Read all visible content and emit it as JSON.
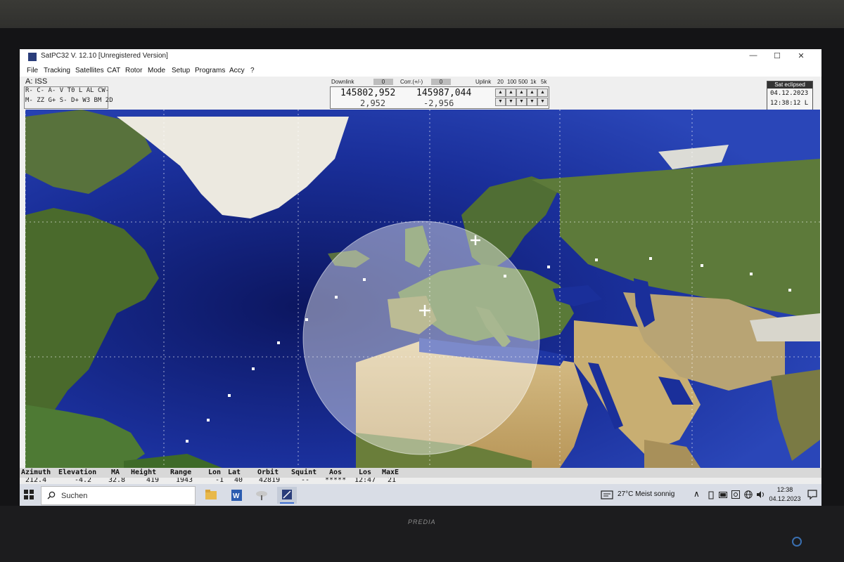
{
  "window": {
    "title": "SatPC32 V. 12.10   [Unregistered Version]",
    "controls": [
      "—",
      "☐",
      "✕"
    ]
  },
  "menu": [
    "File",
    "Tracking",
    "Satellites",
    "CAT",
    "Rotor",
    "Mode",
    "Setup",
    "Programs",
    "Accy",
    "?"
  ],
  "satellite": "A: ISS",
  "modes": {
    "line1": "R- C- A-  V  T0  L  AL  CW-",
    "line2": "M- ZZ G+  S-  D+  W3  BM  2D"
  },
  "frequency": {
    "downlink_label": "Downlink",
    "downlink_value": "0",
    "corr_label": "Corr.(+/-)",
    "corr_value": "0",
    "uplink_label": "Uplink",
    "steps": [
      "20",
      "100",
      "500",
      "1k",
      "5k"
    ],
    "downlink_freq": "145802,952",
    "uplink_freq": "145987,044",
    "downlink_shift": "2,952",
    "uplink_shift": "-2,956"
  },
  "status": {
    "state": "Sat eclipsed",
    "date": "04.12.2023",
    "time": "12:38:12 L"
  },
  "table": {
    "headers": [
      "Azimuth",
      "Elevation",
      "MA",
      "Height",
      "Range",
      "Lon",
      "Lat",
      "Orbit",
      "Squint",
      "Aos",
      "Los",
      "MaxE"
    ],
    "row": [
      "212.4",
      "-4.2",
      "32.8",
      "419",
      "1943",
      "-1",
      "40",
      "42819",
      "--",
      "*****",
      "12:47",
      "21"
    ]
  },
  "taskbar": {
    "search_placeholder": "Suchen",
    "weather": "27°C  Meist sonnig",
    "time": "12:38",
    "date": "04.12.2023"
  },
  "monitor_brand": "PREDIA",
  "colors": {
    "ocean": "#1a2f9a",
    "deep_ocean": "#0c1660",
    "footprint": "#ffffff"
  }
}
